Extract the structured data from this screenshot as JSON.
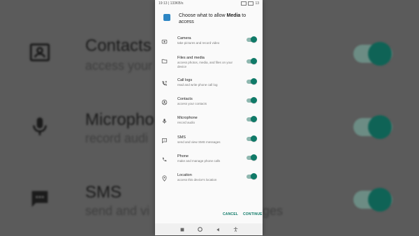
{
  "status_bar": {
    "time": "19:13",
    "speed": "133KB/s",
    "battery": "13"
  },
  "dialog": {
    "prefix": "Choose what to allow ",
    "app_name": "Media",
    "suffix": " to access"
  },
  "permissions": [
    {
      "icon": "camera-icon",
      "name": "Camera",
      "desc": "take pictures and record video",
      "enabled": true
    },
    {
      "icon": "folder-icon",
      "name": "Files and media",
      "desc": "access photos, media, and files on your device",
      "enabled": true
    },
    {
      "icon": "call-log-icon",
      "name": "Call logs",
      "desc": "read and write phone call log",
      "enabled": true
    },
    {
      "icon": "contacts-icon",
      "name": "Contacts",
      "desc": "access your contacts",
      "enabled": true
    },
    {
      "icon": "microphone-icon",
      "name": "Microphone",
      "desc": "record audio",
      "enabled": true
    },
    {
      "icon": "sms-icon",
      "name": "SMS",
      "desc": "send and view SMS messages",
      "enabled": true
    },
    {
      "icon": "phone-icon",
      "name": "Phone",
      "desc": "make and manage phone calls",
      "enabled": true
    },
    {
      "icon": "location-icon",
      "name": "Location",
      "desc": "access this device's location",
      "enabled": true
    }
  ],
  "buttons": {
    "cancel": "CANCEL",
    "continue": "CONTINUE"
  },
  "background": {
    "rows": [
      {
        "title": "Contacts",
        "sub": "access your"
      },
      {
        "title": "Micropho",
        "sub": "record audi"
      },
      {
        "title": "SMS",
        "sub": "send and vi"
      }
    ],
    "right_fragment": "ges"
  },
  "colors": {
    "accent": "#0f7a68",
    "toggle_track": "#8fb8b0",
    "app_icon": "#2d86c4"
  }
}
